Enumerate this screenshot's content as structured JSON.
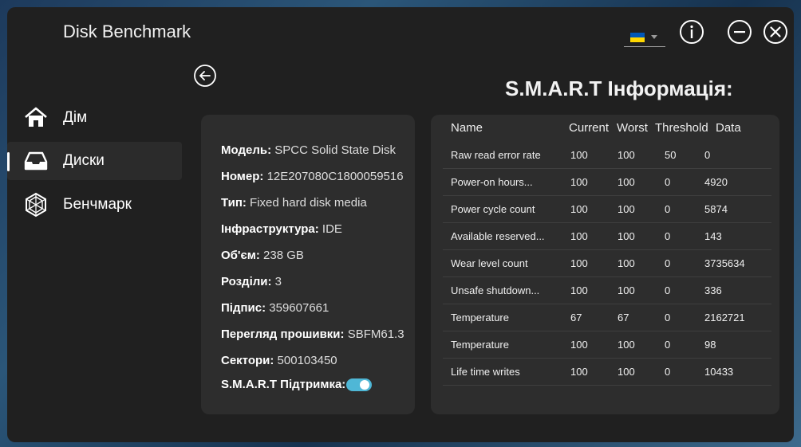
{
  "app": {
    "title": "Disk Benchmark"
  },
  "titlebar": {
    "language_flag": "ukraine-flag-icon",
    "info_icon": "info-icon",
    "minimize_icon": "minimize-icon",
    "close_icon": "close-icon"
  },
  "sidebar": {
    "items": [
      {
        "label": "Дім",
        "icon": "home-icon",
        "active": false
      },
      {
        "label": "Диски",
        "icon": "drive-tray-icon",
        "active": true
      },
      {
        "label": "Бенчмарк",
        "icon": "benchmark-icon",
        "active": false
      }
    ]
  },
  "disk_info": {
    "rows": [
      {
        "key": "Модель:",
        "value": "SPCC Solid State Disk"
      },
      {
        "key": "Номер:",
        "value": "12E207080C1800059516"
      },
      {
        "key": "Тип:",
        "value": "Fixed hard disk media"
      },
      {
        "key": "Інфраструктура:",
        "value": "IDE"
      },
      {
        "key": "Об'єм:",
        "value": "238 GB"
      },
      {
        "key": "Розділи:",
        "value": "3"
      },
      {
        "key": "Підпис:",
        "value": "359607661"
      },
      {
        "key": "Перегляд прошивки:",
        "value": "SBFM61.3"
      },
      {
        "key": "Сектори:",
        "value": "500103450"
      }
    ],
    "smart_support": {
      "label": "S.M.A.R.T Підтримка:",
      "enabled": true
    }
  },
  "smart": {
    "title": "S.M.A.R.T Інформація:",
    "columns": [
      "Name",
      "Current",
      "Worst",
      "Threshold",
      "Data"
    ],
    "rows": [
      [
        "Raw read error rate",
        "100",
        "100",
        "50",
        "0"
      ],
      [
        "Power-on hours...",
        "100",
        "100",
        "0",
        "4920"
      ],
      [
        "Power cycle count",
        "100",
        "100",
        "0",
        "5874"
      ],
      [
        "Available reserved...",
        "100",
        "100",
        "0",
        "143"
      ],
      [
        "Wear level count",
        "100",
        "100",
        "0",
        "3735634"
      ],
      [
        "Unsafe shutdown...",
        "100",
        "100",
        "0",
        "336"
      ],
      [
        "Temperature",
        "67",
        "67",
        "0",
        "2162721"
      ],
      [
        "Temperature",
        "100",
        "100",
        "0",
        "98"
      ],
      [
        "Life time writes",
        "100",
        "100",
        "0",
        "10433"
      ]
    ]
  }
}
